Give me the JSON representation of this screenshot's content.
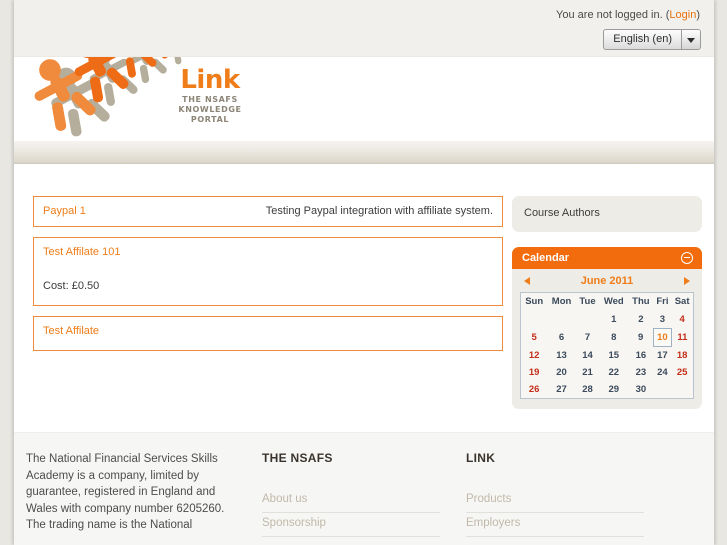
{
  "topbar": {
    "login_prefix": "You are not logged in. (",
    "login_link": "Login",
    "login_suffix": ")",
    "language_value": "English (en)",
    "caret_icon": "chevron-down-icon"
  },
  "logo": {
    "wordmark": "Link",
    "line1": "THE NSAFS",
    "line2": "KNOWLEDGE",
    "line3": "PORTAL",
    "orange": "#ef7d1a",
    "gray": "#a9a294"
  },
  "main": {
    "items": [
      {
        "title": "Paypal 1",
        "description": "Testing Paypal integration with affiliate system.",
        "cost": ""
      },
      {
        "title": "Test Affilate 101",
        "description": "",
        "cost": "Cost: £0.50"
      },
      {
        "title": "Test Affilate",
        "description": "",
        "cost": ""
      }
    ]
  },
  "sidebar": {
    "course_authors": {
      "title": "Course Authors"
    },
    "calendar": {
      "title": "Calendar",
      "collapse_icon": "minus-circle-icon",
      "prev_icon": "prev-arrow-icon",
      "next_icon": "next-arrow-icon",
      "month_label": "June 2011",
      "weekdays": [
        "Sun",
        "Mon",
        "Tue",
        "Wed",
        "Thu",
        "Fri",
        "Sat"
      ],
      "weeks": [
        [
          "",
          "",
          "",
          "1",
          "2",
          "3",
          "4"
        ],
        [
          "5",
          "6",
          "7",
          "8",
          "9",
          "10",
          "11"
        ],
        [
          "12",
          "13",
          "14",
          "15",
          "16",
          "17",
          "18"
        ],
        [
          "19",
          "20",
          "21",
          "22",
          "23",
          "24",
          "25"
        ],
        [
          "26",
          "27",
          "28",
          "29",
          "30",
          "",
          ""
        ]
      ],
      "today": "10",
      "accent": "#f26c0d",
      "weekend_color": "#c42d18",
      "weekday_color": "#3b4a5c"
    }
  },
  "footer": {
    "blurb": "The National Financial Services Skills Academy is a company, limited by guarantee, registered in England and Wales with company number 6205260. The trading name is the National",
    "columns": [
      {
        "heading": "THE NSAFS",
        "links": [
          "About us",
          "Sponsorship"
        ]
      },
      {
        "heading": "LINK",
        "links": [
          "Products",
          "Employers"
        ]
      }
    ]
  }
}
